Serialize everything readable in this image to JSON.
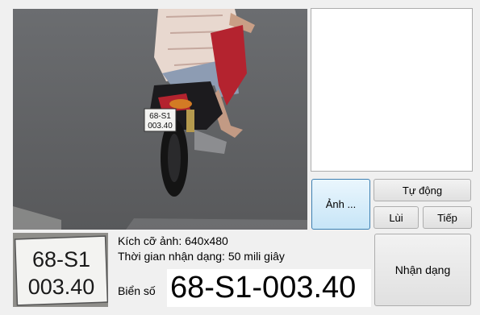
{
  "image_info": {
    "size_text": "Kích cỡ ảnh: 640x480",
    "time_text": "Thời gian nhận dạng: 50 mili giây"
  },
  "result": {
    "label": "Biển số",
    "plate": "68-S1-003.40"
  },
  "buttons": {
    "image": "Ảnh ...",
    "auto": "Tự động",
    "back": "Lùi",
    "next": "Tiếp",
    "recognize": "Nhận dạng"
  },
  "photo": {
    "plate_line1": "68-S1",
    "plate_line2": "003.40"
  }
}
